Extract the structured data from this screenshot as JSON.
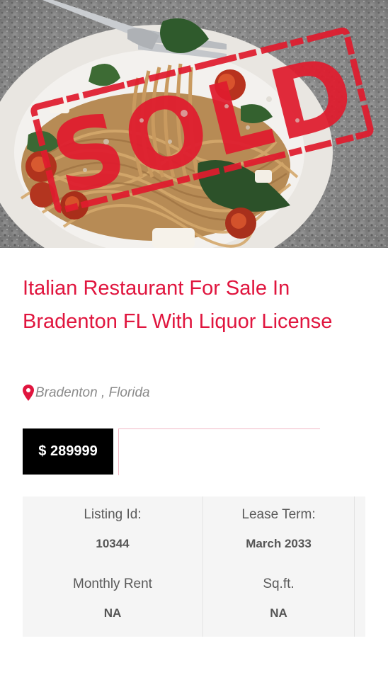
{
  "listing": {
    "image_alt": "Italian pasta dish with SOLD stamp",
    "stamp_text": "SOLD",
    "title": "Italian Restaurant For Sale In Bradenton FL With Liquor License",
    "location": "Bradenton , Florida",
    "price": "$ 289999",
    "details": {
      "listing_id_label": "Listing Id:",
      "listing_id_value": "10344",
      "lease_term_label": "Lease Term:",
      "lease_term_value": "March 2033",
      "monthly_rent_label": "Monthly Rent",
      "monthly_rent_value": "NA",
      "sqft_label": "Sq.ft.",
      "sqft_value": "NA"
    }
  },
  "colors": {
    "accent": "#e0153e",
    "price_bg": "#000000",
    "details_bg": "#f5f5f5",
    "location_text": "#8a8a8a"
  },
  "icons": {
    "location": "map-pin-icon"
  }
}
